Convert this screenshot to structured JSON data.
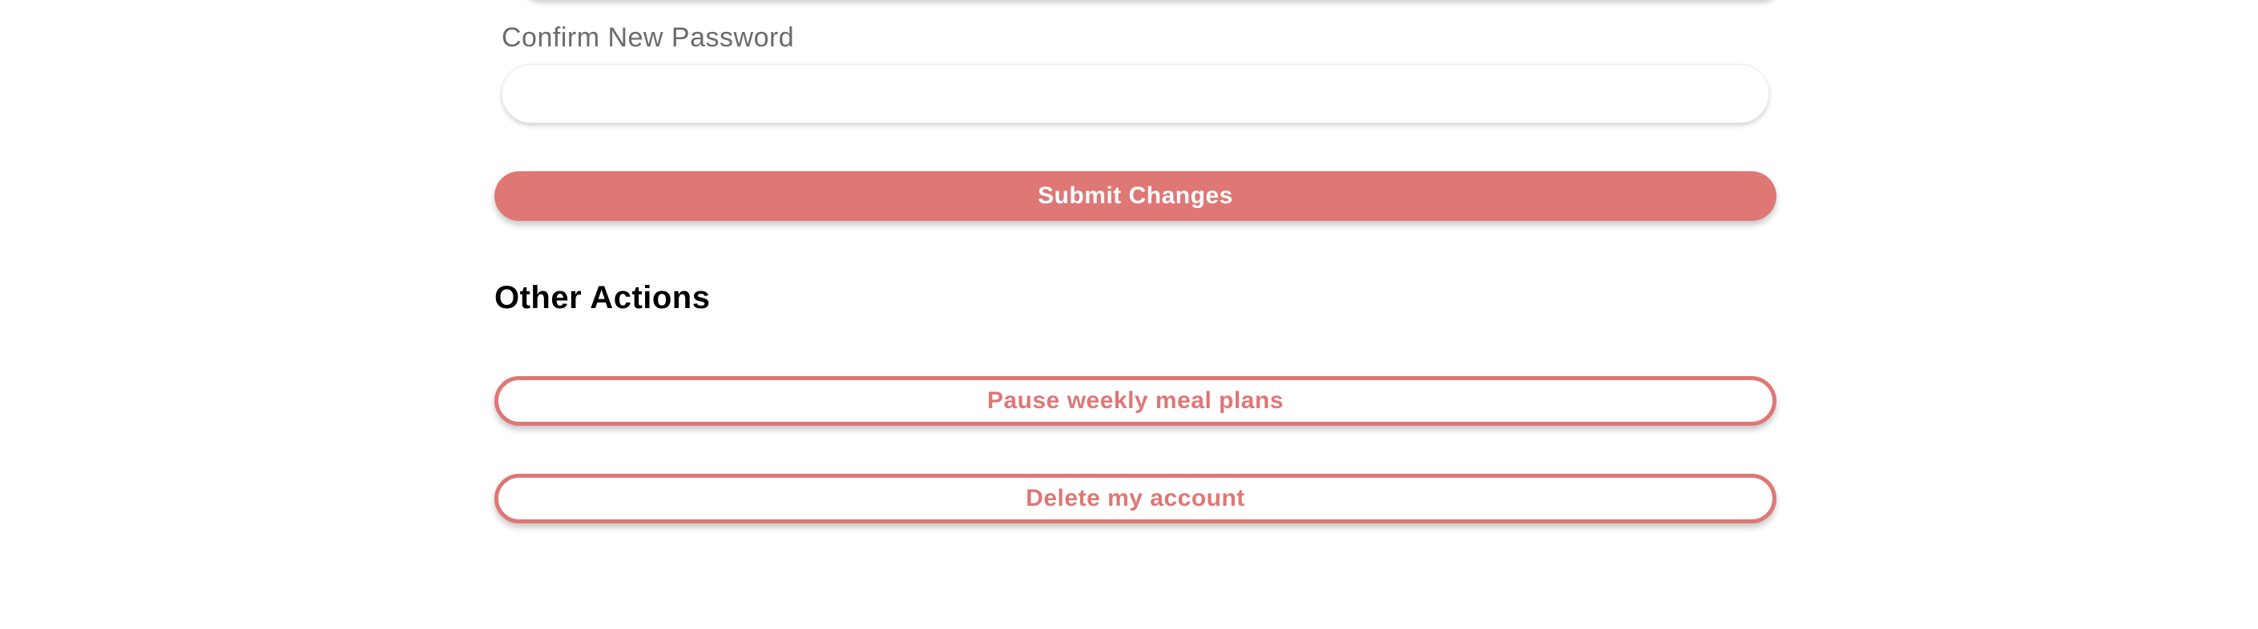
{
  "password_form": {
    "confirm_label": "Confirm New Password",
    "confirm_value": "",
    "confirm_placeholder": "",
    "submit_label": "Submit Changes"
  },
  "other_actions": {
    "title": "Other Actions",
    "pause_label": "Pause weekly meal plans",
    "delete_label": "Delete my account"
  },
  "colors": {
    "accent": "#df7775",
    "label_text": "#6b6b6b",
    "heading_text": "#000000",
    "background": "#ffffff"
  }
}
